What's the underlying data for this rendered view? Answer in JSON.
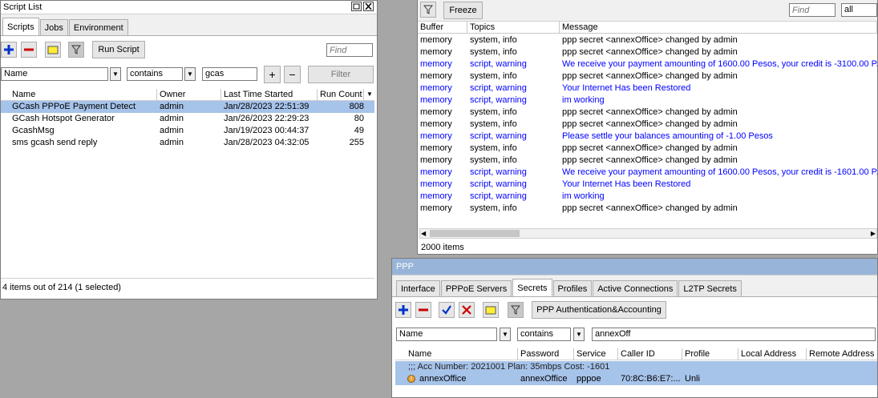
{
  "script_list": {
    "title": "Script List",
    "tabs": [
      "Scripts",
      "Jobs",
      "Environment"
    ],
    "run_script_label": "Run Script",
    "find_placeholder": "Find",
    "filter": {
      "field": "Name",
      "op": "contains",
      "value": "gcas",
      "button": "Filter"
    },
    "columns": [
      "Name",
      "Owner",
      "Last Time Started",
      "Run Count"
    ],
    "rows": [
      {
        "name": "GCash PPPoE Payment Detect",
        "owner": "admin",
        "last": "Jan/28/2023 22:51:39",
        "count": "808",
        "selected": true
      },
      {
        "name": "GCash Hotspot Generator",
        "owner": "admin",
        "last": "Jan/26/2023 22:29:23",
        "count": "80"
      },
      {
        "name": "GcashMsg",
        "owner": "admin",
        "last": "Jan/19/2023 00:44:37",
        "count": "49"
      },
      {
        "name": "sms gcash send reply",
        "owner": "admin",
        "last": "Jan/28/2023 04:32:05",
        "count": "255"
      }
    ],
    "status": "4 items out of 214 (1 selected)"
  },
  "log": {
    "freeze_label": "Freeze",
    "find_placeholder": "Find",
    "scope_value": "all",
    "columns": [
      "Buffer",
      "Topics",
      "Message"
    ],
    "rows": [
      {
        "buffer": "memory",
        "topics": "system, info",
        "message": "ppp secret <annexOffice> changed by admin",
        "warn": false
      },
      {
        "buffer": "memory",
        "topics": "system, info",
        "message": "ppp secret <annexOffice> changed by admin",
        "warn": false
      },
      {
        "buffer": "memory",
        "topics": "script, warning",
        "message": "We receive your payment amounting of 1600.00 Pesos, your credit is -3100.00 P...",
        "warn": true
      },
      {
        "buffer": "memory",
        "topics": "system, info",
        "message": "ppp secret <annexOffice> changed by admin",
        "warn": false
      },
      {
        "buffer": "memory",
        "topics": "script, warning",
        "message": "Your Internet Has been Restored",
        "warn": true
      },
      {
        "buffer": "memory",
        "topics": "script, warning",
        "message": "im working",
        "warn": true
      },
      {
        "buffer": "memory",
        "topics": "system, info",
        "message": "ppp secret <annexOffice> changed by admin",
        "warn": false
      },
      {
        "buffer": "memory",
        "topics": "system, info",
        "message": "ppp secret <annexOffice> changed by admin",
        "warn": false
      },
      {
        "buffer": "memory",
        "topics": "script, warning",
        "message": "Please settle your balances amounting of -1.00 Pesos",
        "warn": true
      },
      {
        "buffer": "memory",
        "topics": "system, info",
        "message": "ppp secret <annexOffice> changed by admin",
        "warn": false
      },
      {
        "buffer": "memory",
        "topics": "system, info",
        "message": "ppp secret <annexOffice> changed by admin",
        "warn": false
      },
      {
        "buffer": "memory",
        "topics": "script, warning",
        "message": "We receive your payment amounting of 1600.00 Pesos, your credit is -1601.00 P...",
        "warn": true
      },
      {
        "buffer": "memory",
        "topics": "script, warning",
        "message": "Your Internet Has been Restored",
        "warn": true
      },
      {
        "buffer": "memory",
        "topics": "script, warning",
        "message": "im working",
        "warn": true
      },
      {
        "buffer": "memory",
        "topics": "system, info",
        "message": "ppp secret <annexOffice> changed by admin",
        "warn": false
      }
    ],
    "status": "2000 items"
  },
  "ppp": {
    "title": "PPP",
    "tabs": [
      "Interface",
      "PPPoE Servers",
      "Secrets",
      "Profiles",
      "Active Connections",
      "L2TP Secrets"
    ],
    "active_tab": "Secrets",
    "auth_button": "PPP Authentication&Accounting",
    "filter": {
      "field": "Name",
      "op": "contains",
      "value": "annexOff"
    },
    "columns": [
      "Name",
      "Password",
      "Service",
      "Caller ID",
      "Profile",
      "Local Address",
      "Remote Address"
    ],
    "comment": ";;; Acc Number: 2021001 Plan: 35mbps Cost: -1601",
    "rows": [
      {
        "name": "annexOffice",
        "password": "annexOffice",
        "service": "pppoe",
        "caller_id": "70:8C:B6:E7:...",
        "profile": "Unli",
        "local": "",
        "remote": ""
      }
    ]
  },
  "colors": {
    "selection": "#a6c3ea",
    "warning_text": "#0000ff",
    "ppp_title": "#98b4d8"
  }
}
